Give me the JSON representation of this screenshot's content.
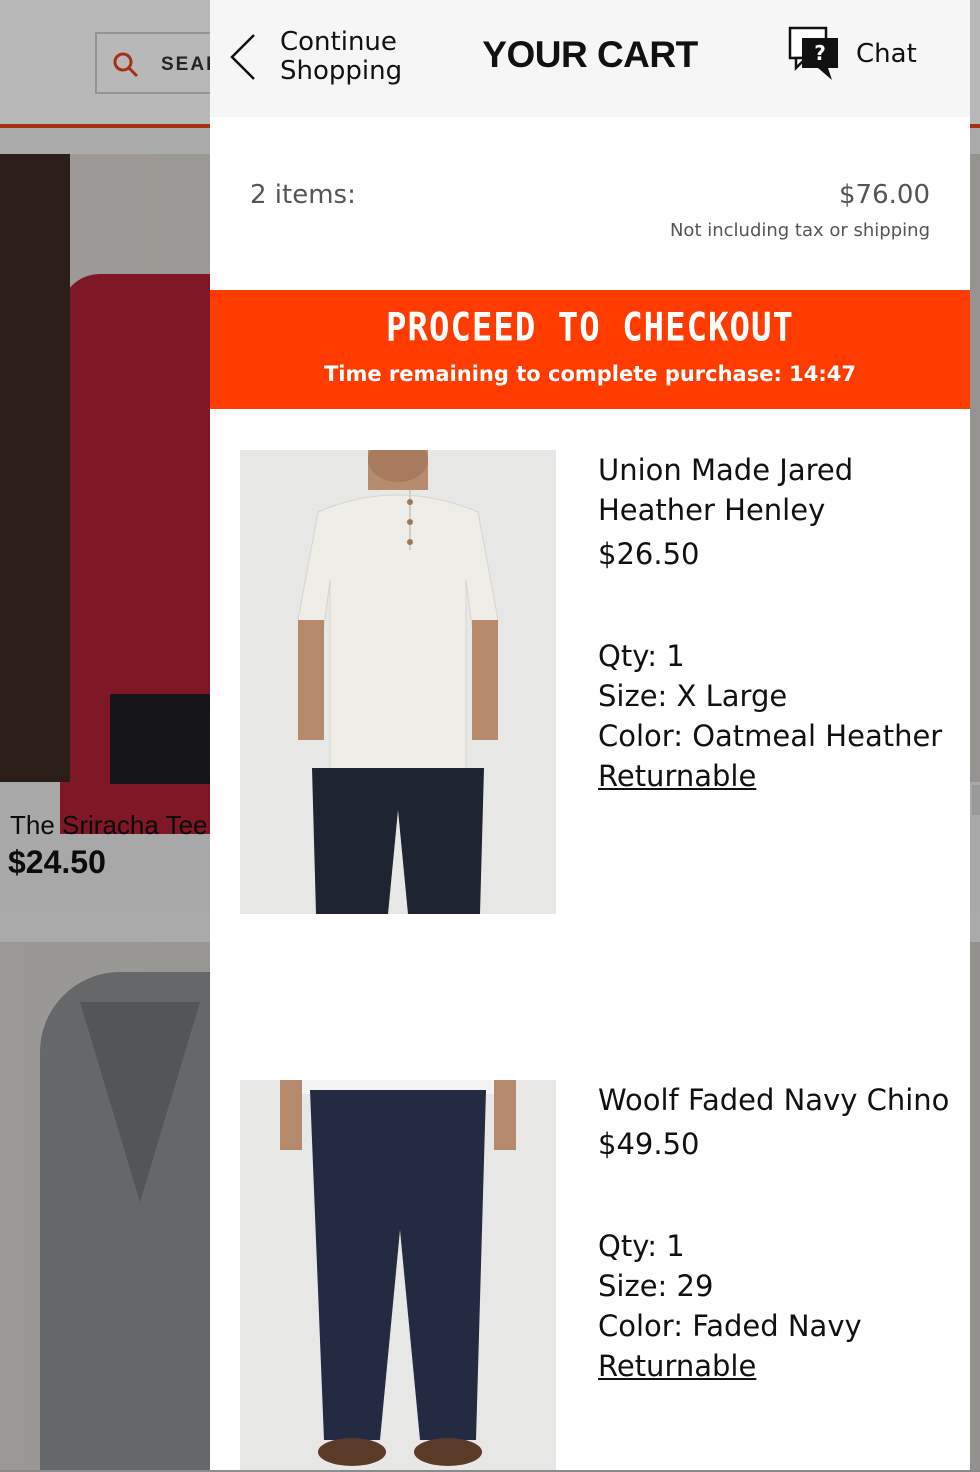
{
  "background_page": {
    "search_placeholder": "SEARCH",
    "product_name": "The Sriracha Tee",
    "product_price": "$24.50"
  },
  "cart": {
    "continue_label": "Continue Shopping",
    "title": "YOUR CART",
    "chat_label": "Chat",
    "item_count_label": "2 items:",
    "subtotal": "$76.00",
    "subtotal_note": "Not including tax or shipping",
    "checkout_label": "PROCEED TO CHECKOUT",
    "timer_label": "Time remaining to complete purchase: 14:47",
    "items": [
      {
        "name": "Union Made Jared Heather Henley",
        "price": "$26.50",
        "qty": "Qty: 1",
        "size": "Size: X Large",
        "color": "Color: Oatmeal Heather",
        "returnable": "Returnable"
      },
      {
        "name": "Woolf Faded Navy Chino",
        "price": "$49.50",
        "qty": "Qty: 1",
        "size": "Size: 29",
        "color": "Color: Faded Navy",
        "returnable": "Returnable"
      }
    ]
  },
  "colors": {
    "accent": "#ff3b00",
    "header_bg": "#f6f6f6",
    "text": "#111111",
    "muted": "#555555"
  },
  "icons": [
    "chevron-left-icon",
    "chat-help-icon",
    "search-icon"
  ]
}
